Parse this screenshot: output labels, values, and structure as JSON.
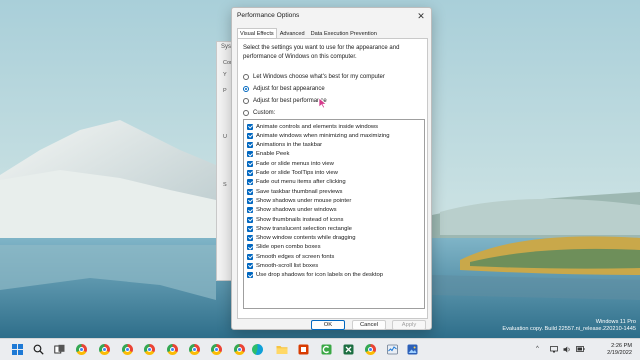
{
  "dialog": {
    "title": "Performance Options",
    "close_symbol": "✕",
    "tabs": [
      "Visual Effects",
      "Advanced",
      "Data Execution Prevention"
    ],
    "intro": "Select the settings you want to use for the appearance and performance of Windows on this computer.",
    "options": [
      {
        "label": "Let Windows choose what's best for my computer",
        "checked": false
      },
      {
        "label": "Adjust for best appearance",
        "checked": true
      },
      {
        "label": "Adjust for best performance",
        "checked": false
      },
      {
        "label": "Custom:",
        "checked": false
      }
    ],
    "effects": [
      "Animate controls and elements inside windows",
      "Animate windows when minimizing and maximizing",
      "Animations in the taskbar",
      "Enable Peek",
      "Fade or slide menus into view",
      "Fade or slide ToolTips into view",
      "Fade out menu items after clicking",
      "Save taskbar thumbnail previews",
      "Show shadows under mouse pointer",
      "Show shadows under windows",
      "Show thumbnails instead of icons",
      "Show translucent selection rectangle",
      "Show window contents while dragging",
      "Slide open combo boxes",
      "Smooth edges of screen fonts",
      "Smooth-scroll list boxes",
      "Use drop shadows for icon labels on the desktop"
    ],
    "effects_checked": true,
    "buttons": {
      "ok": "OK",
      "cancel": "Cancel",
      "apply": "Apply"
    }
  },
  "background_window": {
    "title": "Syst",
    "lines": [
      "Com",
      "Y",
      "P",
      "U",
      "S"
    ]
  },
  "watermark": {
    "line1": "Windows 11 Pro",
    "line2": "Evaluation copy. Build 22557.ni_release.220210-1445"
  },
  "taskbar": {
    "time": "2:26 PM",
    "date": "2/19/2022",
    "icons": [
      "windows-start",
      "search",
      "task-view",
      "chrome",
      "chrome",
      "chrome",
      "chrome",
      "chrome",
      "chrome",
      "chrome",
      "chrome",
      "chrome",
      "edge",
      "file-explorer",
      "office",
      "camtasia",
      "excel",
      "chrome",
      "taskmgr",
      "photos"
    ],
    "tray_chevron": "^"
  },
  "colors": {
    "accent": "#0067c0",
    "dialog_bg": "#f3f3f3",
    "taskbar_bg": "#ebedf0"
  }
}
